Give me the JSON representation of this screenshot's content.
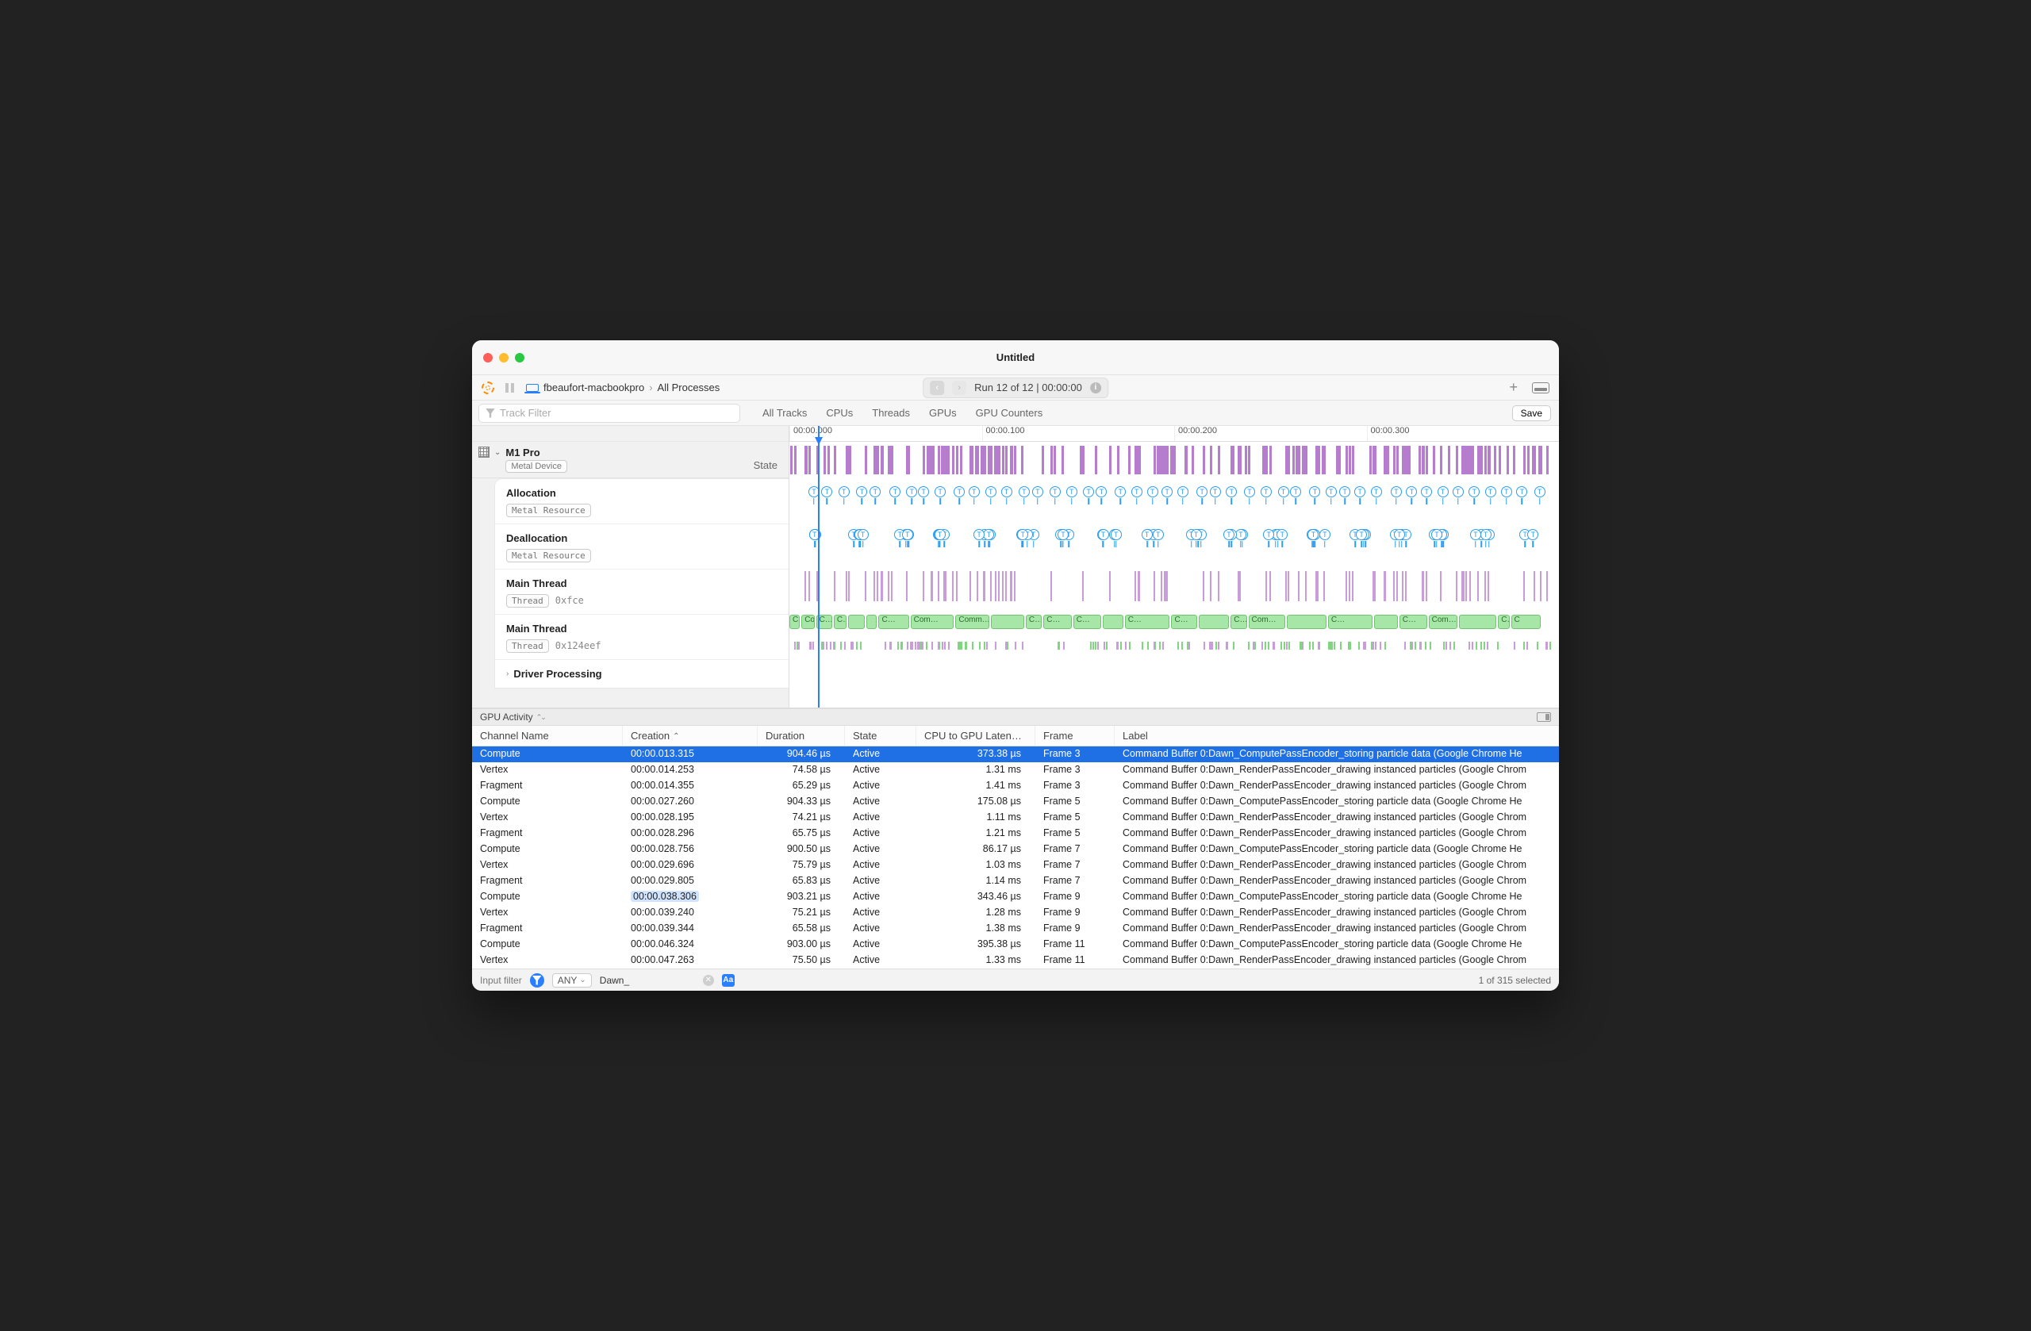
{
  "window": {
    "title": "Untitled"
  },
  "toolbar": {
    "host": "fbeaufort-macbookpro",
    "breadcrumb_sep": "›",
    "scope": "All Processes",
    "run_text": "Run 12 of 12  |  00:00:00"
  },
  "filterbar": {
    "track_filter_placeholder": "Track Filter",
    "tabs": [
      "All Tracks",
      "CPUs",
      "Threads",
      "GPUs",
      "GPU Counters"
    ],
    "save": "Save"
  },
  "time_axis": [
    "00:00.000",
    "00:00.100",
    "00:00.200",
    "00:00.300"
  ],
  "sidebar": {
    "device_name": "M1 Pro",
    "device_badge": "Metal Device",
    "state_label": "State",
    "tracks": [
      {
        "title": "Allocation",
        "badge": "Metal Resource",
        "meta": ""
      },
      {
        "title": "Deallocation",
        "badge": "Metal Resource",
        "meta": ""
      },
      {
        "title": "Main Thread",
        "badge": "Thread",
        "meta": "0xfce"
      },
      {
        "title": "Main Thread",
        "badge": "Thread",
        "meta": "0x124eef"
      }
    ],
    "driver_row": "Driver Processing"
  },
  "green_labels": [
    "C…",
    "Com…",
    "C…",
    "C…",
    "",
    "",
    "C…",
    "Com…",
    "Comm…",
    "",
    "C…",
    "C…",
    "C…",
    "",
    "C…",
    "C…",
    "",
    "C…",
    "Com…",
    "",
    "C…",
    "",
    "C…",
    "Com…",
    "",
    "C…",
    "C"
  ],
  "panel": {
    "title": "GPU Activity"
  },
  "columns": [
    "Channel Name",
    "Creation",
    "Duration",
    "State",
    "CPU to GPU Laten…",
    "Frame",
    "Label"
  ],
  "sort_column_index": 1,
  "rows": [
    {
      "ch": "Compute",
      "cr": "00:00.013.315",
      "du": "904.46 µs",
      "st": "Active",
      "lat": "373.38 µs",
      "fr": "Frame 3",
      "lab": "Command Buffer 0:Dawn_ComputePassEncoder_storing particle data   (Google Chrome He",
      "sel": true
    },
    {
      "ch": "Vertex",
      "cr": "00:00.014.253",
      "du": "74.58 µs",
      "st": "Active",
      "lat": "1.31 ms",
      "fr": "Frame 3",
      "lab": "Command Buffer 0:Dawn_RenderPassEncoder_drawing instanced particles   (Google Chrom"
    },
    {
      "ch": "Fragment",
      "cr": "00:00.014.355",
      "du": "65.29 µs",
      "st": "Active",
      "lat": "1.41 ms",
      "fr": "Frame 3",
      "lab": "Command Buffer 0:Dawn_RenderPassEncoder_drawing instanced particles   (Google Chrom"
    },
    {
      "ch": "Compute",
      "cr": "00:00.027.260",
      "du": "904.33 µs",
      "st": "Active",
      "lat": "175.08 µs",
      "fr": "Frame 5",
      "lab": "Command Buffer 0:Dawn_ComputePassEncoder_storing particle data   (Google Chrome He"
    },
    {
      "ch": "Vertex",
      "cr": "00:00.028.195",
      "du": "74.21 µs",
      "st": "Active",
      "lat": "1.11 ms",
      "fr": "Frame 5",
      "lab": "Command Buffer 0:Dawn_RenderPassEncoder_drawing instanced particles   (Google Chrom"
    },
    {
      "ch": "Fragment",
      "cr": "00:00.028.296",
      "du": "65.75 µs",
      "st": "Active",
      "lat": "1.21 ms",
      "fr": "Frame 5",
      "lab": "Command Buffer 0:Dawn_RenderPassEncoder_drawing instanced particles   (Google Chrom"
    },
    {
      "ch": "Compute",
      "cr": "00:00.028.756",
      "du": "900.50 µs",
      "st": "Active",
      "lat": "86.17 µs",
      "fr": "Frame 7",
      "lab": "Command Buffer 0:Dawn_ComputePassEncoder_storing particle data   (Google Chrome He"
    },
    {
      "ch": "Vertex",
      "cr": "00:00.029.696",
      "du": "75.79 µs",
      "st": "Active",
      "lat": "1.03 ms",
      "fr": "Frame 7",
      "lab": "Command Buffer 0:Dawn_RenderPassEncoder_drawing instanced particles   (Google Chrom"
    },
    {
      "ch": "Fragment",
      "cr": "00:00.029.805",
      "du": "65.83 µs",
      "st": "Active",
      "lat": "1.14 ms",
      "fr": "Frame 7",
      "lab": "Command Buffer 0:Dawn_RenderPassEncoder_drawing instanced particles   (Google Chrom"
    },
    {
      "ch": "Compute",
      "cr": "00:00.038.306",
      "du": "903.21 µs",
      "st": "Active",
      "lat": "343.46 µs",
      "fr": "Frame 9",
      "lab": "Command Buffer 0:Dawn_ComputePassEncoder_storing particle data   (Google Chrome He",
      "hl": true
    },
    {
      "ch": "Vertex",
      "cr": "00:00.039.240",
      "du": "75.21 µs",
      "st": "Active",
      "lat": "1.28 ms",
      "fr": "Frame 9",
      "lab": "Command Buffer 0:Dawn_RenderPassEncoder_drawing instanced particles   (Google Chrom"
    },
    {
      "ch": "Fragment",
      "cr": "00:00.039.344",
      "du": "65.58 µs",
      "st": "Active",
      "lat": "1.38 ms",
      "fr": "Frame 9",
      "lab": "Command Buffer 0:Dawn_RenderPassEncoder_drawing instanced particles   (Google Chrom"
    },
    {
      "ch": "Compute",
      "cr": "00:00.046.324",
      "du": "903.00 µs",
      "st": "Active",
      "lat": "395.38 µs",
      "fr": "Frame 11",
      "lab": "Command Buffer 0:Dawn_ComputePassEncoder_storing particle data   (Google Chrome He"
    },
    {
      "ch": "Vertex",
      "cr": "00:00.047.263",
      "du": "75.50 µs",
      "st": "Active",
      "lat": "1.33 ms",
      "fr": "Frame 11",
      "lab": "Command Buffer 0:Dawn_RenderPassEncoder_drawing instanced particles   (Google Chrom"
    }
  ],
  "footer": {
    "label": "Input filter",
    "any": "ANY",
    "query": "Dawn_",
    "status": "1 of 315 selected"
  }
}
